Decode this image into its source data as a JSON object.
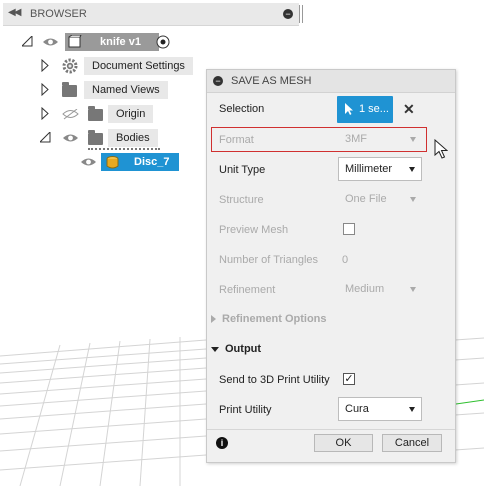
{
  "browser": {
    "title": "BROWSER",
    "items": [
      {
        "label": "knife v1",
        "depth": 0
      },
      {
        "label": "Document Settings",
        "depth": 1
      },
      {
        "label": "Named Views",
        "depth": 1
      },
      {
        "label": "Origin",
        "depth": 1
      },
      {
        "label": "Bodies",
        "depth": 1
      },
      {
        "label": "Disc_7",
        "depth": 2
      }
    ]
  },
  "dialog": {
    "title": "SAVE AS MESH",
    "selection": {
      "label": "Selection",
      "value": "1 se..."
    },
    "format": {
      "label": "Format",
      "value": "3MF"
    },
    "unit_type": {
      "label": "Unit Type",
      "value": "Millimeter"
    },
    "structure": {
      "label": "Structure",
      "value": "One File"
    },
    "preview_mesh": {
      "label": "Preview Mesh"
    },
    "num_triangles": {
      "label": "Number of Triangles",
      "value": "0"
    },
    "refinement": {
      "label": "Refinement",
      "value": "Medium"
    },
    "refinement_options": "Refinement Options",
    "output": "Output",
    "send_to_print": {
      "label": "Send to 3D Print Utility",
      "check": "✓"
    },
    "print_utility": {
      "label": "Print Utility",
      "value": "Cura"
    },
    "ok": "OK",
    "cancel": "Cancel"
  },
  "colors": {
    "accent": "#1f93d3",
    "highlight_border": "#d03030"
  }
}
